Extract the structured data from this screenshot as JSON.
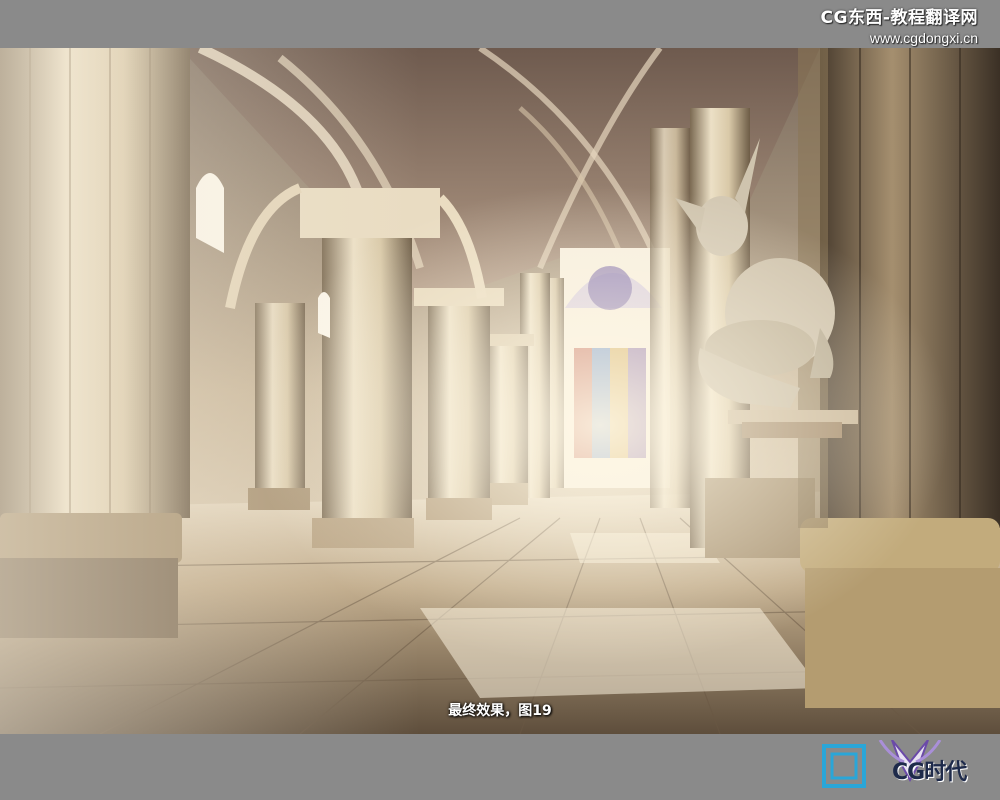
{
  "watermark": {
    "title": "CG东西-教程翻译网",
    "url": "www.cgdongxi.cn"
  },
  "caption": "最终效果，图19",
  "logo": {
    "text": "CG时代"
  },
  "colors": {
    "frame_gray": "#8a8a8a",
    "stone_light": "#e6d8bd",
    "stone_dark": "#6b5a45",
    "floor": "#b8a486",
    "glass_red": "#c0392b",
    "glass_blue": "#3a6fc0"
  }
}
